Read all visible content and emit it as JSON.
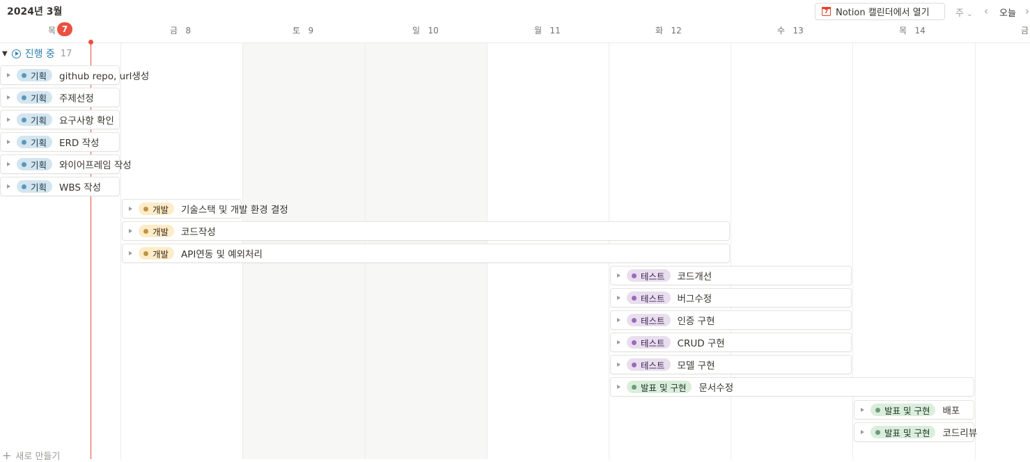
{
  "header": {
    "month": "2024년 3월",
    "notion_button": "Notion 캘린더에서 열기",
    "calendar_icon_day": "7",
    "view_selector": "주",
    "today_button": "오늘"
  },
  "days": [
    {
      "label": "목",
      "num": "7",
      "today": true
    },
    {
      "label": "금",
      "num": "8"
    },
    {
      "label": "토",
      "num": "9"
    },
    {
      "label": "일",
      "num": "10"
    },
    {
      "label": "월",
      "num": "11"
    },
    {
      "label": "화",
      "num": "12"
    },
    {
      "label": "수",
      "num": "13"
    },
    {
      "label": "목",
      "num": "14"
    },
    {
      "label": "금",
      "num": ""
    }
  ],
  "group": {
    "name": "진행 중",
    "count": "17"
  },
  "tasks": [
    {
      "tag": "기획",
      "title": "github repo, url생성"
    },
    {
      "tag": "기획",
      "title": "주제선정"
    },
    {
      "tag": "기획",
      "title": "요구사항 확인"
    },
    {
      "tag": "기획",
      "title": "ERD 작성"
    },
    {
      "tag": "기획",
      "title": "와이어프레임 작성"
    },
    {
      "tag": "기획",
      "title": "WBS 작성"
    },
    {
      "tag": "개발",
      "title": "기술스택 및 개발 환경 결정"
    },
    {
      "tag": "개발",
      "title": "코드작성"
    },
    {
      "tag": "개발",
      "title": "API연동 및 예외처리"
    },
    {
      "tag": "테스트",
      "title": "코드개선"
    },
    {
      "tag": "테스트",
      "title": "버그수정"
    },
    {
      "tag": "테스트",
      "title": "인증 구현"
    },
    {
      "tag": "테스트",
      "title": "CRUD 구현"
    },
    {
      "tag": "테스트",
      "title": "모델 구현"
    },
    {
      "tag": "발표 및 구현",
      "title": "문서수정"
    },
    {
      "tag": "발표 및 구현",
      "title": "배포"
    },
    {
      "tag": "발표 및 구현",
      "title": "코드리뷰"
    }
  ],
  "new_item": "새로 만들기",
  "colors": {
    "today": "#eb5040",
    "group": "#2f7fae",
    "tag_plan": "#d3e5ef",
    "tag_dev": "#fdecc8",
    "tag_test": "#e8deee",
    "tag_presentation": "#dbeddb"
  },
  "icons": [
    "calendar-icon",
    "chevron-down-icon",
    "chevron-left-icon",
    "chevron-right-icon",
    "in-progress-icon",
    "toggle-icon",
    "plus-icon"
  ]
}
